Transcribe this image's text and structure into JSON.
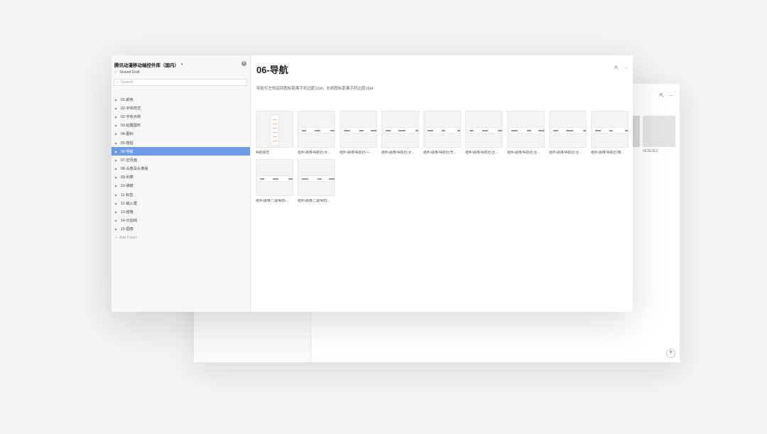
{
  "project": {
    "title": "腾讯动漫移动端控件库（国内）",
    "shared": "Shared Draft"
  },
  "search": {
    "placeholder": "Search"
  },
  "folders": [
    {
      "label": "01-颜色"
    },
    {
      "label": "02-字体样式"
    },
    {
      "label": "02-字体示例"
    },
    {
      "label": "03-延展图形"
    },
    {
      "label": "04-图标"
    },
    {
      "label": "05-按钮"
    },
    {
      "label": "06-导航"
    },
    {
      "label": "07-空页面"
    },
    {
      "label": "08-头像及头像组"
    },
    {
      "label": "09-列表"
    },
    {
      "label": "10-弹窗"
    },
    {
      "label": "11-标签"
    },
    {
      "label": "12-输入框"
    },
    {
      "label": "13-宫格"
    },
    {
      "label": "14-分割线"
    },
    {
      "label": "15-圆角"
    }
  ],
  "active_folder_index": 6,
  "add_folder": "Add Folder",
  "page": {
    "title": "06-导航",
    "description": "导航栏左侧返回图标距离手机边距12pt，右侧图标距离手机边距16pt"
  },
  "cards": [
    {
      "label": "导航规范"
    },
    {
      "label": "组件/通用/导航栏/文..."
    },
    {
      "label": "组件/通用/导航栏/一..."
    },
    {
      "label": "组件/通用/导航栏/文..."
    },
    {
      "label": "组件/通用/导航栏/无..."
    },
    {
      "label": "组件/通用/导航栏/主..."
    },
    {
      "label": "组件/通用/导航栏/主..."
    },
    {
      "label": "组件/通用/导航栏/主..."
    },
    {
      "label": "组件/通用/导航栏/两..."
    },
    {
      "label": "组件/通用/二级导航/..."
    },
    {
      "label": "组件/通用/二级导航/..."
    }
  ],
  "back_window": {
    "thumb_label": "#E2E2E2"
  },
  "colors": {
    "accent": "#6d9be5"
  }
}
